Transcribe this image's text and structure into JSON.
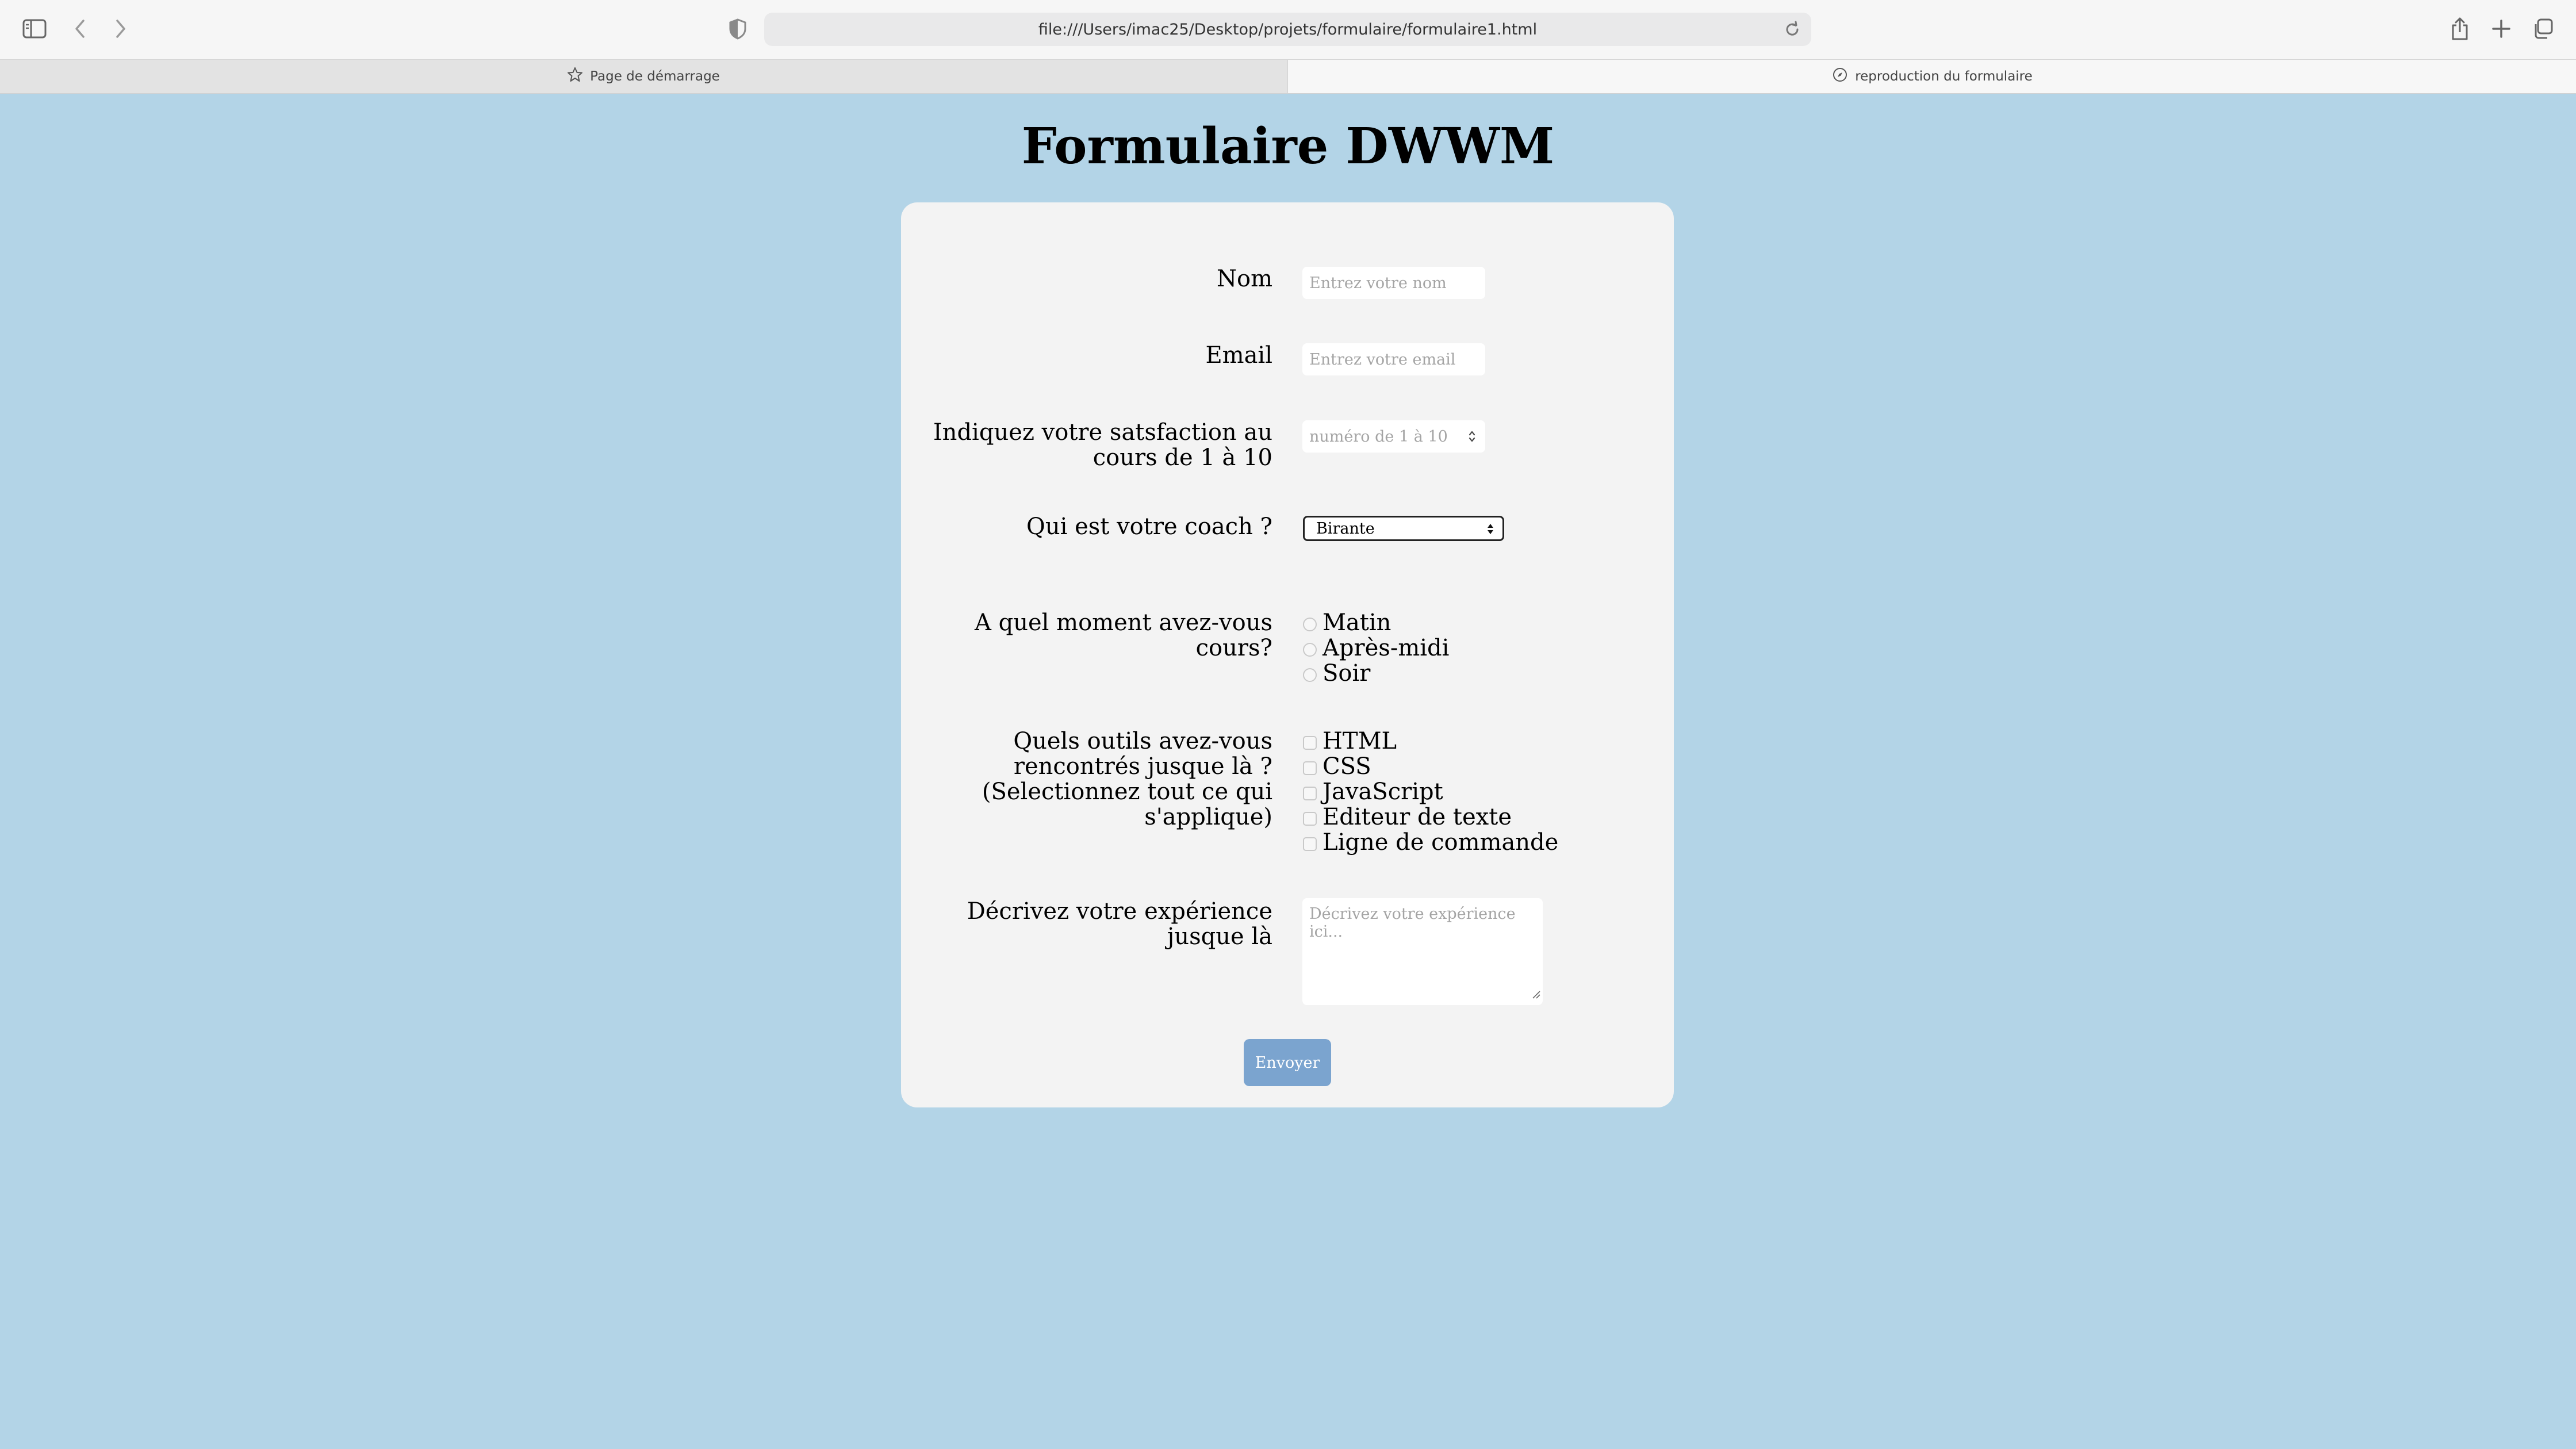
{
  "browser": {
    "url": "file:///Users/imac25/Desktop/projets/formulaire/formulaire1.html",
    "tabs": [
      {
        "label": "Page de démarrage",
        "active": false
      },
      {
        "label": "reproduction du formulaire",
        "active": true
      }
    ]
  },
  "page": {
    "title": "Formulaire DWWM",
    "background_color": "#b3d4e7",
    "card_color": "#f3f3f3"
  },
  "form": {
    "name": {
      "label": "Nom",
      "placeholder": "Entrez votre nom"
    },
    "email": {
      "label": "Email",
      "placeholder": "Entrez votre email"
    },
    "satisfaction": {
      "label": "Indiquez votre satsfaction au cours de 1 à 10",
      "placeholder": "numéro de 1 à 10"
    },
    "coach": {
      "label": "Qui est votre coach ?",
      "selected": "Birante"
    },
    "moment": {
      "label": "A quel moment avez-vous cours?",
      "options": [
        "Matin",
        "Après-midi",
        "Soir"
      ]
    },
    "tools": {
      "label": "Quels outils avez-vous rencontrés jusque là ? (Selectionnez tout ce qui s'applique)",
      "options": [
        "HTML",
        "CSS",
        "JavaScript",
        "Editeur de texte",
        "Ligne de commande"
      ]
    },
    "experience": {
      "label": "Décrivez votre expérience jusque là",
      "placeholder": "Décrivez votre expérience ici..."
    },
    "submit_label": "Envoyer",
    "submit_color": "#7ba4cf"
  }
}
